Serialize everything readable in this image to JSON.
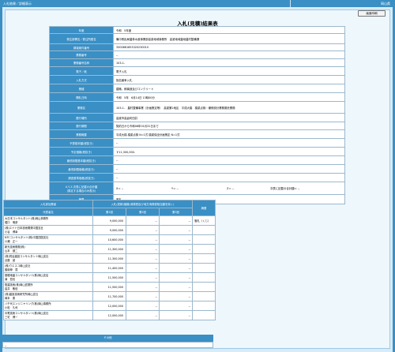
{
  "topbar": {
    "breadcrumb": "入札結果／詳細表示",
    "prefecture": "岡山県"
  },
  "print_label": "画面印刷",
  "title": "入札(見積)結果表",
  "main_rows": [
    {
      "label": "年度",
      "value": "令和　5年度",
      "h": 9
    },
    {
      "label": "発注部署名／発注所属名",
      "value": "備中県民局農林水産事業部高梁地域事務所　高梁地域農地農村整備課",
      "h": 13
    },
    {
      "label": "調達案件番号",
      "value": "3300881853320230010",
      "h": 9
    },
    {
      "label": "業務番号",
      "value": "--",
      "h": 10
    },
    {
      "label": "業務番号名称",
      "value": "103-1-",
      "h": 10
    },
    {
      "label": "電子／紙",
      "value": "電子入札",
      "h": 11
    },
    {
      "label": "入札方式",
      "value": "指名競争入札",
      "h": 11
    },
    {
      "label": "業種",
      "value": "建築、積構造及びコンクリート",
      "h": 11
    },
    {
      "label": "開札日時",
      "value": "令和　5年　6月14日 13時00分",
      "h": 11
    },
    {
      "label": "業務名",
      "value": "103-1-　農村整備事業（計画策定等）　高梁第2地区　平成大橋　橋梁点検・補修設計業務委託業務",
      "h": 15
    },
    {
      "label": "履行場所",
      "value": "高梁市高倉町田井",
      "h": 11
    },
    {
      "label": "履行期間",
      "value": "契約日から令和06年01月31日まで",
      "h": 10
    },
    {
      "label": "業務概要",
      "value": "平成大橋 橋梁点検 N=1式 橋梁保全計画策定 N=1式",
      "h": 11
    },
    {
      "label": "予算基本額(税抜き)",
      "value": "--",
      "h": 11
    },
    {
      "label": "予定価格(税抜き)",
      "value": "￥11,300,000-",
      "h": 11
    },
    {
      "label": "最低制限基本額(税抜き)",
      "value": "--",
      "h": 11
    },
    {
      "label": "最低制限価格(税抜き)",
      "value": "--",
      "h": 11
    },
    {
      "label": "調査基準価格(税抜き)",
      "value": "--",
      "h": 11
    },
    {
      "label": "X,Y,Z,次表に記載の合計額\n(算定する場合のみ表示)",
      "value_xyz": [
        "X＝ --",
        "Y＝ --",
        "Z＝ --",
        "次表に記載の合計額＝ --"
      ],
      "h": 16
    },
    {
      "label": "摘要",
      "value": "落札",
      "h": 12
    }
  ],
  "bid_table": {
    "header_company": "入札参加業者",
    "header_amount": "入札(見積)価格(消費税及び地方消費税相当額を除く)",
    "header_remarks": "摘要",
    "sub_headers": [
      "代表者名",
      "第1回",
      "第2回",
      "第3回"
    ],
    "rows": [
      {
        "name": "大日本コンサルタント(株)岡山事務所\n堀口　明彦",
        "r1": "9,000,000",
        "r2": "--",
        "r3": "--",
        "note": "落札（くじ）"
      },
      {
        "name": "(株)エイト日本技術開発中国支社\n小谷　博幸",
        "r1": "9,000,000",
        "r2": "--",
        "r3": "--",
        "note": ""
      },
      {
        "name": "NTCコンサルタンツ(株)中国四国支社\n川瀬　正一",
        "r1": "10,600,000",
        "r2": "--",
        "r3": "--",
        "note": ""
      },
      {
        "name": "新光技術開発(株)\n山本　健二",
        "r1": "11,300,000",
        "r2": "--",
        "r3": "--",
        "note": ""
      },
      {
        "name": "(株)荒谷建設コンサルタント岡山支社\n近藤　誠",
        "r1": "11,300,000",
        "r2": "--",
        "r3": "--",
        "note": ""
      },
      {
        "name": "(株)ウエスコ岡山支社\n藤原伸　賢",
        "r1": "11,400,000",
        "r2": "--",
        "r3": "--",
        "note": ""
      },
      {
        "name": "基礎地盤コンサルタンツ(株)岡山支店\n溝　哲也",
        "r1": "11,500,000",
        "r2": "--",
        "r3": "--",
        "note": ""
      },
      {
        "name": "復建技術(株)岡山営業所\n金井　敬信",
        "r1": "11,500,000",
        "r2": "--",
        "r3": "--",
        "note": ""
      },
      {
        "name": "(株)建設技術研究所岡山支社\n岡本　泰",
        "r1": "11,700,000",
        "r2": "--",
        "r3": "--",
        "note": ""
      },
      {
        "name": "八千代エンジニヤリング(株)岡山事務所\n小松　久司",
        "r1": "12,000,000",
        "r2": "--",
        "r3": "--",
        "note": ""
      },
      {
        "name": "中電技術コンサルタント(株)岡山支社\n三宅　博一",
        "r1": "12,000,000",
        "r2": "--",
        "r3": "--",
        "note": ""
      }
    ]
  },
  "bottom": {
    "header": "その他",
    "value": "--"
  }
}
